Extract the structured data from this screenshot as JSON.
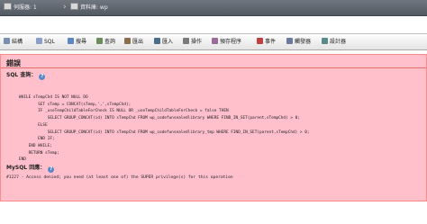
{
  "breadcrumb": {
    "items": [
      {
        "label": "伺服器: 1",
        "icon": "server-icon"
      },
      {
        "label": "資料庫: wp",
        "icon": "database-icon"
      }
    ]
  },
  "tabs": [
    {
      "label": "結構",
      "icon": "structure-icon",
      "color": "#7a8fb0"
    },
    {
      "label": "SQL",
      "icon": "sql-icon",
      "color": "#8aa0c8"
    },
    {
      "label": "搜尋",
      "icon": "search-icon",
      "color": "#5e86c0"
    },
    {
      "label": "查詢",
      "icon": "query-icon",
      "color": "#6c8c5c"
    },
    {
      "label": "匯出",
      "icon": "export-icon",
      "color": "#8d6e4a"
    },
    {
      "label": "匯入",
      "icon": "import-icon",
      "color": "#4a6c8d"
    },
    {
      "label": "操作",
      "icon": "operations-icon",
      "color": "#7a7a7a"
    },
    {
      "label": "預存程序",
      "icon": "routines-icon",
      "color": "#9a6a9a"
    },
    {
      "label": "事件",
      "icon": "events-icon",
      "color": "#c04040"
    },
    {
      "label": "觸發器",
      "icon": "triggers-icon",
      "color": "#6a7aa0"
    },
    {
      "label": "設計器",
      "icon": "designer-icon",
      "color": "#5a8a8a"
    }
  ],
  "error": {
    "title": "錯誤",
    "sql_query_label": "SQL 查詢：",
    "code_lines": [
      "WHILE sTempChd IS NOT NULL DO",
      "        SET sTemp = CONCAT(sTemp,',',sTempChd);",
      "        IF _useTempChildTableForCheck IS NULL OR _useTempChildTableForCheck = false THEN",
      "            SELECT GROUP_CONCAT(id) INTO sTempChd FROM wp_codefunsealedlibrary WHERE FIND_IN_SET(parent,sTempChd) > 0;",
      "        ELSE",
      "            SELECT GROUP_CONCAT(id) INTO sTempChd FROM wp_codefunsealedlibrary_tmp WHERE FIND_IN_SET(parent,sTempChd) > 0;",
      "        END IF;",
      "    END WHILE;",
      "    RETURN sTemp;",
      "END"
    ],
    "mysql_response_label": "MySQL 回應：",
    "message": "#1227 - Access denied; you need (at least one of) the SUPER privilege(s) for this operation"
  }
}
